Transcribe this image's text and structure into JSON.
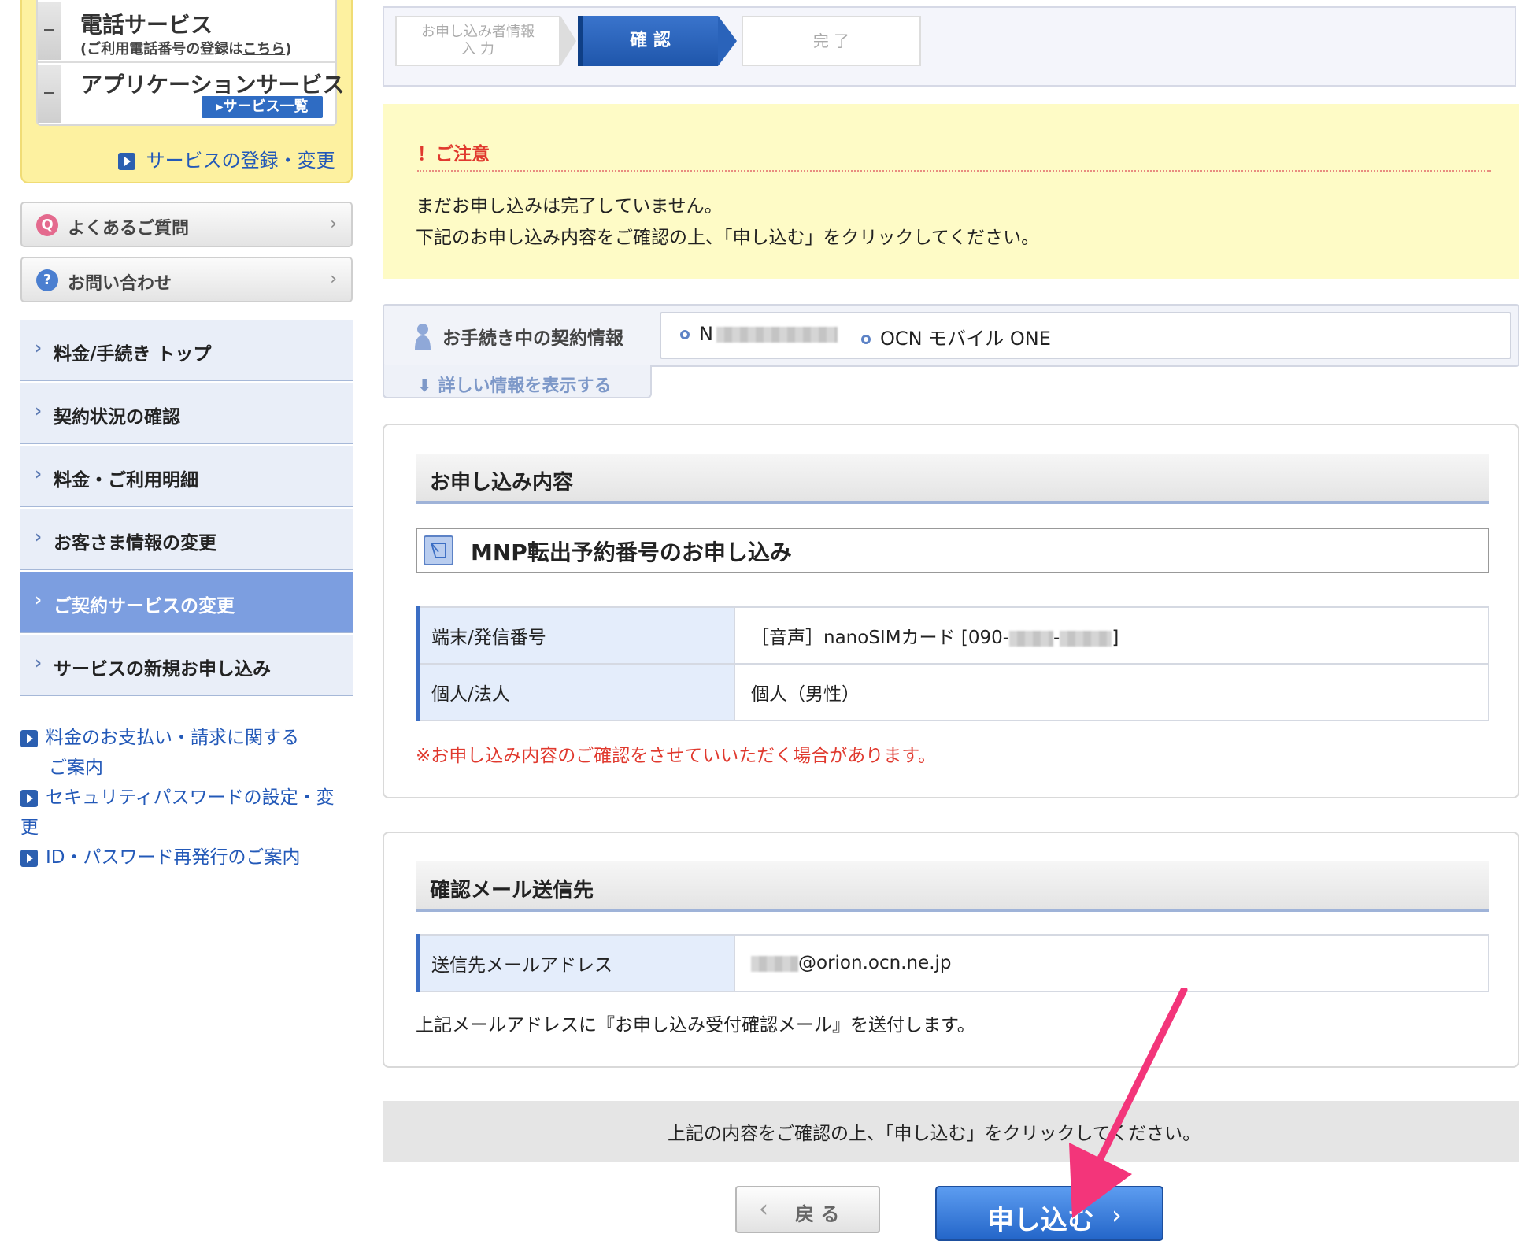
{
  "sidebar": {
    "services": {
      "phone_title": "電話サービス",
      "phone_sub_prefix": "(ご利用電話番号の登録は",
      "phone_sub_link": "こちら",
      "phone_sub_suffix": ")",
      "app_title": "アプリケーションサービス",
      "list_button": "▸サービス一覧",
      "register_link": "サービスの登録・変更"
    },
    "faq_label": "よくあるご質問",
    "contact_label": "お問い合わせ",
    "nav": [
      {
        "label": "料金/手続き トップ"
      },
      {
        "label": "契約状況の確認"
      },
      {
        "label": "料金・ご利用明細"
      },
      {
        "label": "お客さま情報の変更"
      },
      {
        "label": "ご契約サービスの変更"
      },
      {
        "label": "サービスの新規お申し込み"
      }
    ],
    "links": [
      {
        "line1": "料金のお支払い・請求に関する",
        "line2": "ご案内"
      },
      {
        "line1": "セキュリティパスワードの設定・変",
        "line2": "更"
      },
      {
        "line1": "ID・パスワード再発行のご案内"
      }
    ]
  },
  "steps": {
    "step1_line1": "お申し込み者情報",
    "step1_line2": "入 力",
    "step2": "確 認",
    "step3": "完 了"
  },
  "notice": {
    "title": "！ご注意",
    "line1": "まだお申し込みは完了していません。",
    "line2": "下記のお申し込み内容をご確認の上、「申し込む」をクリックしてください。"
  },
  "contract": {
    "label": "お手続き中の契約情報",
    "id_prefix": "N",
    "plan": "OCN モバイル ONE",
    "detail_link": "詳しい情報を表示する"
  },
  "application": {
    "heading": "お申し込み内容",
    "subheading": "MNP転出予約番号のお申し込み",
    "rows": [
      {
        "label": "端末/発信番号",
        "value_prefix": "［音声］nanoSIMカード [090-",
        "value_mid": "-",
        "value_suffix": "]"
      },
      {
        "label": "個人/法人",
        "value": "個人（男性）"
      }
    ],
    "warning": "※お申し込み内容のご確認をさせていいただく場合があります。"
  },
  "mail": {
    "heading": "確認メール送信先",
    "row_label": "送信先メールアドレス",
    "row_value_suffix": "@orion.ocn.ne.jp",
    "note": "上記メールアドレスに『お申し込み受付確認メール』を送付します。"
  },
  "confirm": {
    "text": "上記の内容をご確認の上、「申し込む」をクリックしてください。",
    "back_label": "戻 る",
    "submit_label": "申し込む"
  },
  "colors": {
    "accent_blue": "#2466c9",
    "notice_bg": "#fefbc6",
    "warning_red": "#e0392e",
    "annotation_arrow": "#f3357a"
  }
}
